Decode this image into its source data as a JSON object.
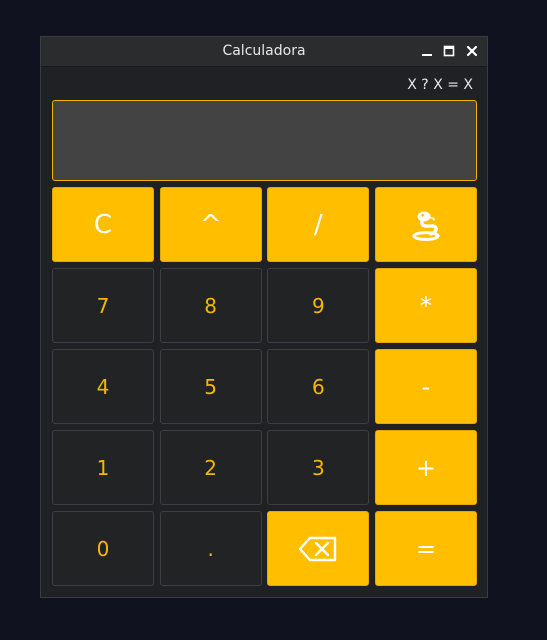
{
  "window": {
    "title": "Calculadora",
    "controls": [
      "minimize-icon",
      "maximize-icon",
      "close-icon"
    ]
  },
  "expression_hint": "X ? X = X",
  "display": {
    "value": ""
  },
  "colors": {
    "accent": "#ffbf00",
    "number_text": "#f6b700",
    "key_dark": "#222325",
    "display_bg": "#434343",
    "page_bg": "#11121f"
  },
  "keys": {
    "clear": "C",
    "power": "^",
    "divide": "/",
    "python": "snake-icon",
    "seven": "7",
    "eight": "8",
    "nine": "9",
    "multiply": "*",
    "four": "4",
    "five": "5",
    "six": "6",
    "minus": "-",
    "one": "1",
    "two": "2",
    "three": "3",
    "plus": "+",
    "zero": "0",
    "dot": ".",
    "backspace": "backspace-icon",
    "equals": "="
  }
}
